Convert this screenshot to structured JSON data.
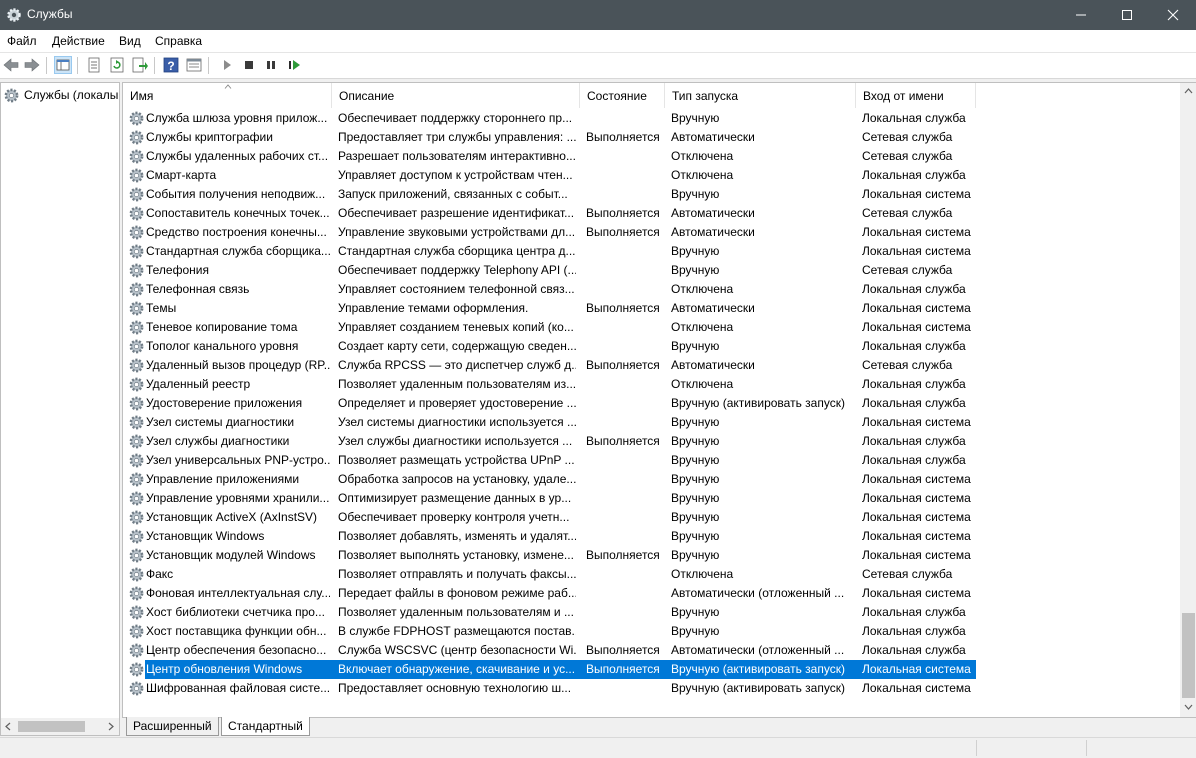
{
  "window": {
    "title": "Службы",
    "icons": {
      "app": "gear-icon",
      "minimize": "minimize-icon",
      "maximize": "maximize-icon",
      "close": "close-icon"
    }
  },
  "menu": [
    "Файл",
    "Действие",
    "Вид",
    "Справка"
  ],
  "toolbar": {
    "icons": [
      "back-arrow-icon",
      "forward-arrow-icon",
      "console-tree-icon",
      "properties-sheet-icon",
      "refresh-icon",
      "export-list-icon",
      "help-icon",
      "details-view-icon",
      "start-icon",
      "stop-icon",
      "pause-icon",
      "resume-icon"
    ]
  },
  "tree": {
    "root_label": "Службы (локалы"
  },
  "columns": {
    "name": "Имя",
    "description": "Описание",
    "state": "Состояние",
    "startup": "Тип запуска",
    "logon": "Вход от имени"
  },
  "services": [
    {
      "name": "Служба шлюза уровня прилож...",
      "description": "Обеспечивает поддержку стороннего пр...",
      "state": "",
      "startup": "Вручную",
      "logon": "Локальная служба"
    },
    {
      "name": "Службы криптографии",
      "description": "Предоставляет три службы управления: ...",
      "state": "Выполняется",
      "startup": "Автоматически",
      "logon": "Сетевая служба"
    },
    {
      "name": "Службы удаленных рабочих ст...",
      "description": "Разрешает пользователям интерактивно...",
      "state": "",
      "startup": "Отключена",
      "logon": "Сетевая служба"
    },
    {
      "name": "Смарт-карта",
      "description": "Управляет доступом к устройствам чтен...",
      "state": "",
      "startup": "Отключена",
      "logon": "Локальная служба"
    },
    {
      "name": "События получения неподвиж...",
      "description": "Запуск приложений, связанных с событ...",
      "state": "",
      "startup": "Вручную",
      "logon": "Локальная система"
    },
    {
      "name": "Сопоставитель конечных точек...",
      "description": "Обеспечивает разрешение идентификат...",
      "state": "Выполняется",
      "startup": "Автоматически",
      "logon": "Сетевая служба"
    },
    {
      "name": "Средство построения конечны...",
      "description": "Управление звуковыми устройствами дл...",
      "state": "Выполняется",
      "startup": "Автоматически",
      "logon": "Локальная система"
    },
    {
      "name": "Стандартная служба сборщика...",
      "description": "Стандартная служба сборщика центра д...",
      "state": "",
      "startup": "Вручную",
      "logon": "Локальная система"
    },
    {
      "name": "Телефония",
      "description": "Обеспечивает поддержку Telephony API (...",
      "state": "",
      "startup": "Вручную",
      "logon": "Сетевая служба"
    },
    {
      "name": "Телефонная связь",
      "description": "Управляет состоянием телефонной связ...",
      "state": "",
      "startup": "Отключена",
      "logon": "Локальная служба"
    },
    {
      "name": "Темы",
      "description": "Управление темами оформления.",
      "state": "Выполняется",
      "startup": "Автоматически",
      "logon": "Локальная система"
    },
    {
      "name": "Теневое копирование тома",
      "description": "Управляет созданием теневых копий (ко...",
      "state": "",
      "startup": "Отключена",
      "logon": "Локальная система"
    },
    {
      "name": "Тополог канального уровня",
      "description": "Создает карту сети, содержащую сведен...",
      "state": "",
      "startup": "Вручную",
      "logon": "Локальная служба"
    },
    {
      "name": "Удаленный вызов процедур (RP...",
      "description": "Служба RPCSS — это диспетчер служб д...",
      "state": "Выполняется",
      "startup": "Автоматически",
      "logon": "Сетевая служба"
    },
    {
      "name": "Удаленный реестр",
      "description": "Позволяет удаленным пользователям из...",
      "state": "",
      "startup": "Отключена",
      "logon": "Локальная служба"
    },
    {
      "name": "Удостоверение приложения",
      "description": "Определяет и проверяет удостоверение ...",
      "state": "",
      "startup": "Вручную (активировать запуск)",
      "logon": "Локальная служба"
    },
    {
      "name": "Узел системы диагностики",
      "description": "Узел системы диагностики используется ...",
      "state": "",
      "startup": "Вручную",
      "logon": "Локальная система"
    },
    {
      "name": "Узел службы диагностики",
      "description": "Узел службы диагностики используется ...",
      "state": "Выполняется",
      "startup": "Вручную",
      "logon": "Локальная служба"
    },
    {
      "name": "Узел универсальных PNP-устро...",
      "description": "Позволяет размещать устройства UPnP ...",
      "state": "",
      "startup": "Вручную",
      "logon": "Локальная служба"
    },
    {
      "name": "Управление приложениями",
      "description": "Обработка запросов на установку, удале...",
      "state": "",
      "startup": "Вручную",
      "logon": "Локальная система"
    },
    {
      "name": "Управление уровнями хранили...",
      "description": "Оптимизирует размещение данных в ур...",
      "state": "",
      "startup": "Вручную",
      "logon": "Локальная система"
    },
    {
      "name": "Установщик ActiveX (AxInstSV)",
      "description": "Обеспечивает проверку контроля учетн...",
      "state": "",
      "startup": "Вручную",
      "logon": "Локальная система"
    },
    {
      "name": "Установщик Windows",
      "description": "Позволяет добавлять, изменять и удалят...",
      "state": "",
      "startup": "Вручную",
      "logon": "Локальная система"
    },
    {
      "name": "Установщик модулей Windows",
      "description": "Позволяет выполнять установку, измене...",
      "state": "Выполняется",
      "startup": "Вручную",
      "logon": "Локальная система"
    },
    {
      "name": "Факс",
      "description": "Позволяет отправлять и получать факсы...",
      "state": "",
      "startup": "Отключена",
      "logon": "Сетевая служба"
    },
    {
      "name": "Фоновая интеллектуальная слу...",
      "description": "Передает файлы в фоновом режиме раб...",
      "state": "",
      "startup": "Автоматически (отложенный ...",
      "logon": "Локальная система"
    },
    {
      "name": "Хост библиотеки счетчика про...",
      "description": "Позволяет удаленным пользователям и ...",
      "state": "",
      "startup": "Вручную",
      "logon": "Локальная служба"
    },
    {
      "name": "Хост поставщика функции обн...",
      "description": "В службе FDPHOST размещаются постав...",
      "state": "",
      "startup": "Вручную",
      "logon": "Локальная служба"
    },
    {
      "name": "Центр обеспечения безопасно...",
      "description": "Служба WSCSVC (центр безопасности Wi...",
      "state": "Выполняется",
      "startup": "Автоматически (отложенный ...",
      "logon": "Локальная служба"
    },
    {
      "name": "Центр обновления Windows",
      "description": "Включает обнаружение, скачивание и ус...",
      "state": "Выполняется",
      "startup": "Вручную (активировать запуск)",
      "logon": "Локальная система",
      "selected": true
    },
    {
      "name": "Шифрованная файловая систе...",
      "description": "Предоставляет основную технологию ш...",
      "state": "",
      "startup": "Вручную (активировать запуск)",
      "logon": "Локальная система"
    }
  ],
  "tabs": [
    "Расширенный",
    "Стандартный"
  ],
  "active_tab": "Стандартный",
  "colors": {
    "titlebar": "#4a5359",
    "selection": "#0078d7"
  }
}
